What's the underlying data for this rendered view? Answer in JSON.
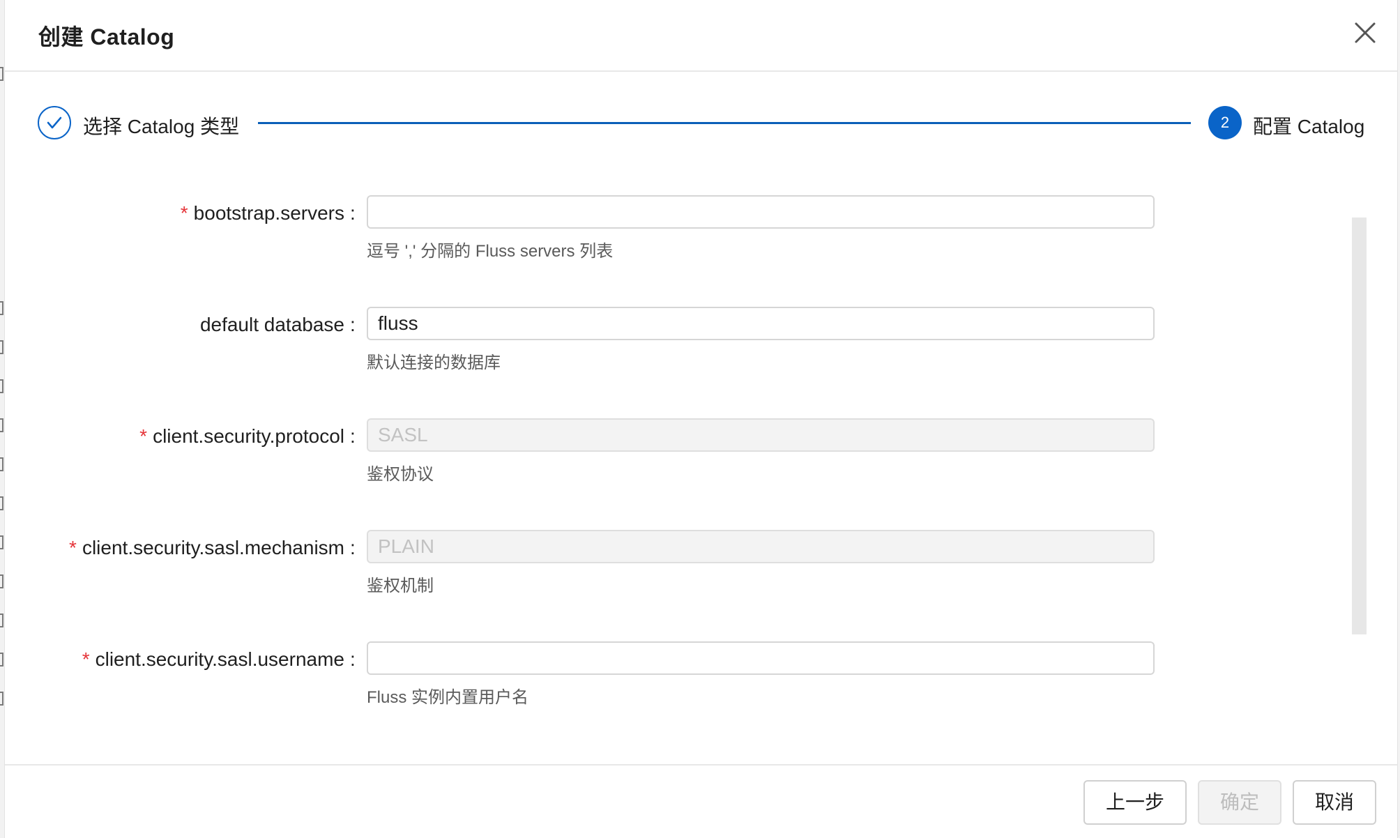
{
  "dialog": {
    "title": "创建 Catalog"
  },
  "steps": [
    {
      "label": "选择 Catalog 类型",
      "status": "done"
    },
    {
      "number": "2",
      "label": "配置 Catalog",
      "status": "active"
    }
  ],
  "form": {
    "colon": ":",
    "required_mark": "*",
    "fields": [
      {
        "label": "bootstrap.servers",
        "required": true,
        "value": "",
        "help": "逗号 ',' 分隔的 Fluss servers 列表",
        "disabled": false
      },
      {
        "label": "default database",
        "required": false,
        "value": "fluss",
        "help": "默认连接的数据库",
        "disabled": false
      },
      {
        "label": "client.security.protocol",
        "required": true,
        "value": "SASL",
        "help": "鉴权协议",
        "disabled": true
      },
      {
        "label": "client.security.sasl.mechanism",
        "required": true,
        "value": "PLAIN",
        "help": "鉴权机制",
        "disabled": true
      },
      {
        "label": "client.security.sasl.username",
        "required": true,
        "value": "",
        "help": "Fluss 实例内置用户名",
        "disabled": false
      }
    ]
  },
  "footer": {
    "prev_label": "上一步",
    "confirm_label": "确定",
    "cancel_label": "取消"
  },
  "colors": {
    "primary": "#0a64c8",
    "required": "#e5353a"
  }
}
